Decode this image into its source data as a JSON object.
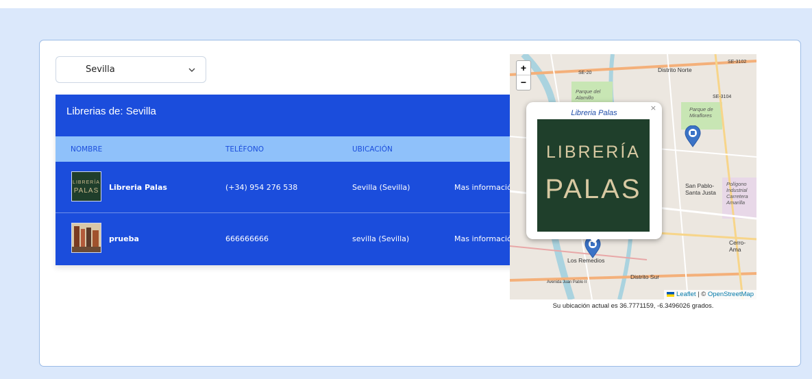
{
  "filter": {
    "selected_city": "Sevilla"
  },
  "panel": {
    "title": "Librerias de: Sevilla",
    "columns": [
      "NOMBRE",
      "TELÉFONO",
      "UBICACIÓN"
    ],
    "rows": [
      {
        "name": "Libreria Palas",
        "phone": "(+34) 954 276 538",
        "location": "Sevilla (Sevilla)",
        "link": "Mas información."
      },
      {
        "name": "prueba",
        "phone": "666666666",
        "location": "sevilla (Sevilla)",
        "link": "Mas información."
      }
    ]
  },
  "map": {
    "zoom_in": "+",
    "zoom_out": "−",
    "popup": {
      "title": "Libreria Palas",
      "close": "×",
      "logo_line1": "LIBRERÍA",
      "logo_line2": "PALAS"
    },
    "labels": {
      "distrito_norte": "Distrito Norte",
      "se20": "SE-20",
      "se3102": "SE-3102",
      "se3104": "SE-3104",
      "parque_alamillo": "Parque del Alamillo",
      "parque_miraflores": "Parque de Miraflores",
      "san_pablo": "San Pablo-Santa Justa",
      "poligono": "Polígono Industrial Carretera Amarilla",
      "cerro": "Cerro-Ama",
      "los_remedios": "Los Remedios",
      "distrito_sur": "Distrito Sur",
      "avenida": "Avenida Juan Pablo II"
    },
    "attribution_leaflet": "Leaflet",
    "attribution_sep": " | © ",
    "attribution_osm": "OpenStreetMap"
  },
  "location_text": "Su ubicación actual es 36.7771159, -6.3496026 grados.",
  "colors": {
    "primary": "#1b4ddc",
    "header": "#8fc1fa",
    "background": "#dbe8fb"
  }
}
